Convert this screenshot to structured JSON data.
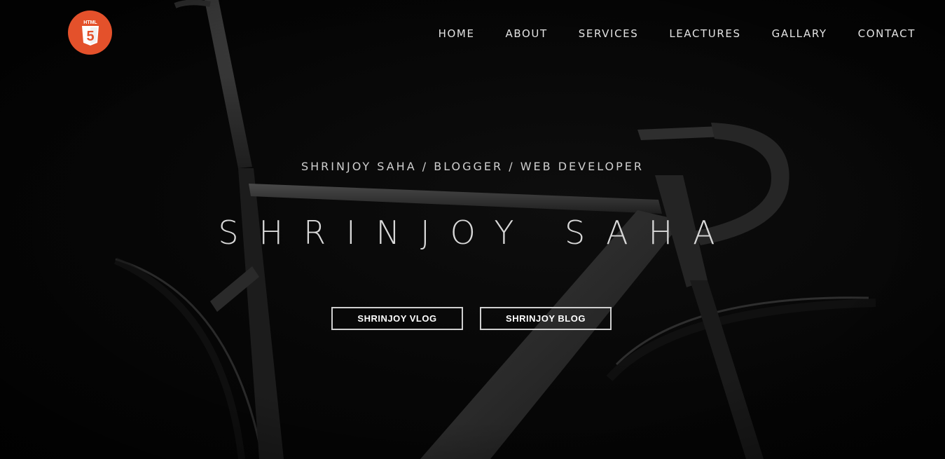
{
  "brand": {
    "logo_text": "HTML",
    "logo_digit": "5",
    "logo_color": "#e4512b"
  },
  "nav": {
    "items": [
      {
        "label": "HOME"
      },
      {
        "label": "ABOUT"
      },
      {
        "label": "SERVICES"
      },
      {
        "label": "LEACTURES"
      },
      {
        "label": "GALLARY"
      },
      {
        "label": "CONTACT"
      }
    ]
  },
  "hero": {
    "subtitle": "SHRINJOY SAHA / BLOGGER / WEB DEVELOPER",
    "title": "SHRINJOY SAHA",
    "buttons": [
      {
        "label": "SHRINJOY VLOG"
      },
      {
        "label": "SHRINJOY BLOG"
      }
    ],
    "background_image": "black racing bicycle frame on dark background"
  }
}
